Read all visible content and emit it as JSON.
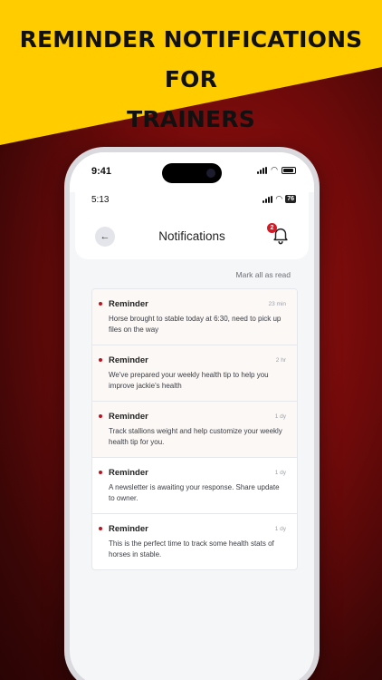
{
  "headline": {
    "line1": "REMINDER NOTIFICATIONS FOR",
    "line2": "TRAINERS"
  },
  "device_status": {
    "time": "9:41"
  },
  "app_status": {
    "time": "5:13",
    "battery": "76"
  },
  "header": {
    "title": "Notifications",
    "badge_count": "2"
  },
  "actions": {
    "mark_all_read": "Mark all as read"
  },
  "notifications": [
    {
      "title": "Reminder",
      "time": "23 min",
      "body": "Horse brought to stable today at 6:30, need to pick up files on the way",
      "unread": true
    },
    {
      "title": "Reminder",
      "time": "2 hr",
      "body": "We've prepared your weekly health tip to help you improve jackie's health",
      "unread": true
    },
    {
      "title": "Reminder",
      "time": "1 dy",
      "body": "Track stallions weight and help customize your weekly health tip for you.",
      "unread": true
    },
    {
      "title": "Reminder",
      "time": "1 dy",
      "body": "A newsletter is awaiting your response. Share update to owner.",
      "unread": false
    },
    {
      "title": "Reminder",
      "time": "1 dy",
      "body": "This is the perfect time to track some health stats of horses in stable.",
      "unread": false
    }
  ],
  "colors": {
    "banner": "#ffcc00",
    "accent": "#c0121e",
    "background_dark_red": "#6e0a0a"
  },
  "icons": {
    "back": "arrow-left-icon",
    "bell": "bell-icon",
    "unread_dot": "dot-icon"
  }
}
